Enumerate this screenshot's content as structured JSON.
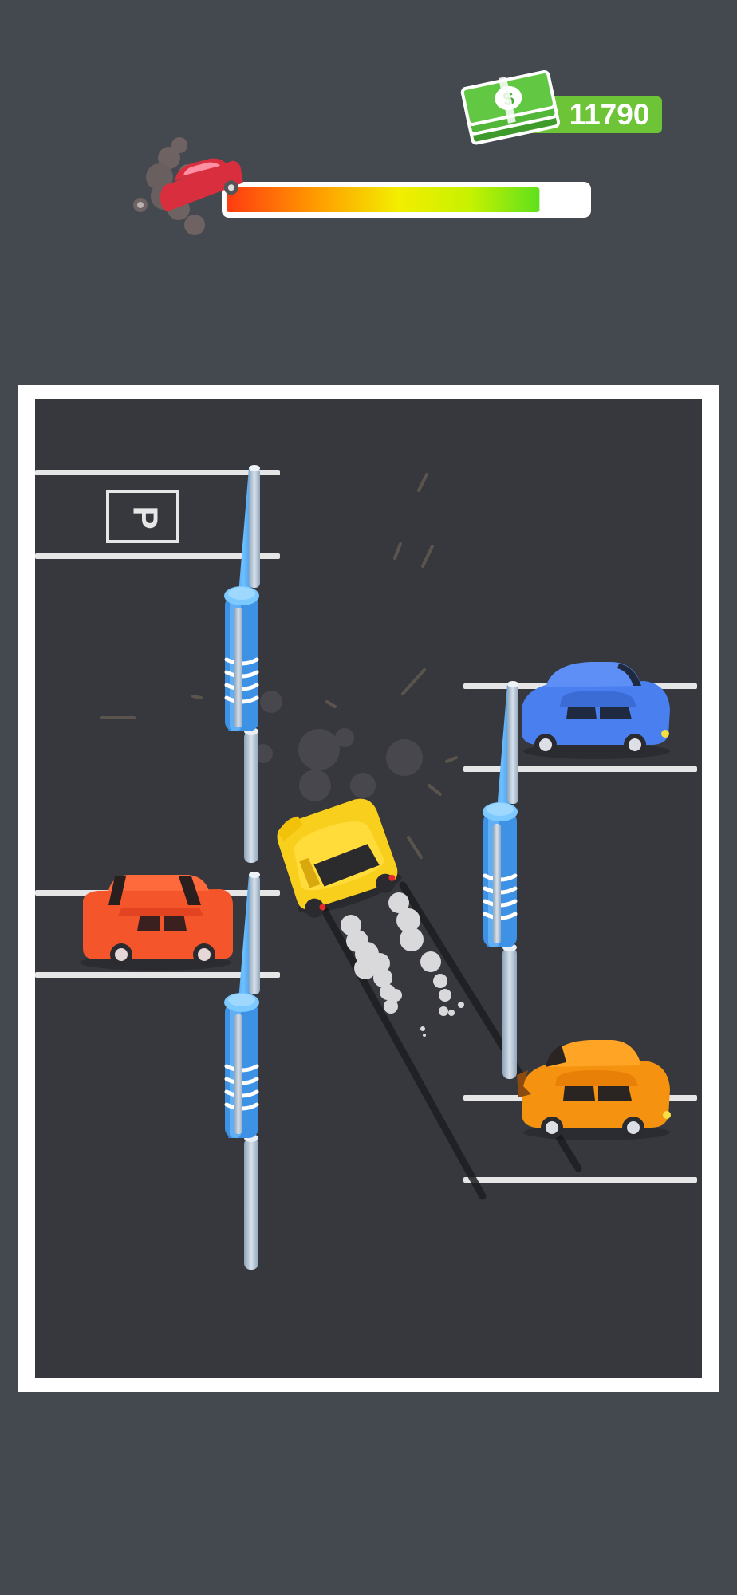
{
  "hud": {
    "cash": "11790",
    "cash_icon": "money-stack-icon",
    "progress_icon": "damaged-car-icon",
    "progress_fraction": 0.87
  },
  "parking_lot": {
    "sign": "P"
  },
  "colors": {
    "background": "#444950",
    "lot_asphalt": "#36383e",
    "lot_border": "#ffffff",
    "player_car": "#f7cf1c",
    "blue_car": "#4a7ff0",
    "red_car": "#f5552a",
    "orange_car": "#f5920f",
    "barrier_blue": "#4ea6f0",
    "cash_green": "#6cc436"
  }
}
